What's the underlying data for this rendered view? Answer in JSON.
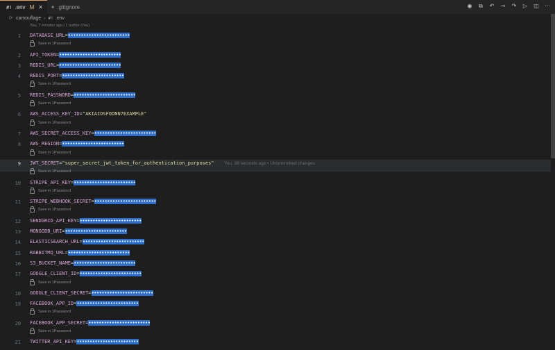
{
  "tabs": [
    {
      "label": ".env",
      "modified": "M",
      "close": "✕",
      "icon": "#!"
    },
    {
      "label": ".gitignore",
      "icon": "◈"
    }
  ],
  "toolbar_icons": [
    "eye-icon",
    "open-changes-icon",
    "history-back-icon",
    "git-commit-icon",
    "history-forward-icon",
    "run-icon",
    "split-editor-icon",
    "more-actions-icon"
  ],
  "breadcrumb": {
    "folder": "camouflage",
    "icon": "#!",
    "file": ".env"
  },
  "blame_header": "You, 7 minutes ago | 1 author (You)",
  "save_hint": "Save in 1Password",
  "current_line_blame": "You, 38 seconds ago • Uncommitted changes",
  "lines": [
    {
      "n": "1",
      "key": "DATABASE_URL",
      "mask": "••••••••••••••••••••••••",
      "hint": true
    },
    {
      "n": "2",
      "key": "API_TOKEN",
      "mask": "••••••••••••••••••••••••"
    },
    {
      "n": "3",
      "key": "REDIS_URL",
      "mask": "••••••••••••••••••••••••"
    },
    {
      "n": "4",
      "key": "REDIS_PORT",
      "mask": "••••••••••••••••••••••••",
      "hint": true
    },
    {
      "n": "5",
      "key": "REDIS_PASSWORD",
      "mask": "••••••••••••••••••••••••",
      "hint": true
    },
    {
      "n": "6",
      "key": "AWS_ACCESS_KEY_ID",
      "value": "\"AKIAIOSFODNN7EXAMPLE\"",
      "hint": true
    },
    {
      "n": "7",
      "key": "AWS_SECRET_ACCESS_KEY",
      "mask": "••••••••••••••••••••••••"
    },
    {
      "n": "8",
      "key": "AWS_REGION",
      "mask": "••••••••••••••••••••••••",
      "hint": true
    },
    {
      "n": "9",
      "key": "JWT_SECRET",
      "value": "\"super_secret_jwt_token_for_authentication_purposes\"",
      "hint": true,
      "current": true
    },
    {
      "n": "10",
      "key": "STRIPE_API_KEY",
      "mask": "••••••••••••••••••••••••",
      "hint": true
    },
    {
      "n": "11",
      "key": "STRIPE_WEBHOOK_SECRET",
      "mask": "••••••••••••••••••••••••",
      "hint": true
    },
    {
      "n": "12",
      "key": "SENDGRID_API_KEY",
      "mask": "••••••••••••••••••••••••"
    },
    {
      "n": "13",
      "key": "MONGODB_URI",
      "mask": "••••••••••••••••••••••••"
    },
    {
      "n": "14",
      "key": "ELASTICSEARCH_URL",
      "mask": "••••••••••••••••••••••••"
    },
    {
      "n": "15",
      "key": "RABBITMQ_URL",
      "mask": "••••••••••••••••••••••••"
    },
    {
      "n": "16",
      "key": "S3_BUCKET_NAME",
      "mask": "••••••••••••••••••••••••"
    },
    {
      "n": "17",
      "key": "GOOGLE_CLIENT_ID",
      "mask": "••••••••••••••••••••••••",
      "hint": true
    },
    {
      "n": "18",
      "key": "GOOGLE_CLIENT_SECRET",
      "mask": "••••••••••••••••••••••••"
    },
    {
      "n": "19",
      "key": "FACEBOOK_APP_ID",
      "mask": "••••••••••••••••••••••••",
      "hint": true
    },
    {
      "n": "20",
      "key": "FACEBOOK_APP_SECRET",
      "mask": "••••••••••••••••••••••••",
      "hint": true
    },
    {
      "n": "21",
      "key": "TWITTER_API_KEY",
      "mask": "••••••••••••••••••••••••"
    }
  ],
  "colors": {
    "background": "#1e1e1e",
    "key": "#d5a5d7",
    "string": "#dcdca6",
    "mask_bg": "#2f6fcc",
    "tab_accent": "#e5a05b"
  }
}
